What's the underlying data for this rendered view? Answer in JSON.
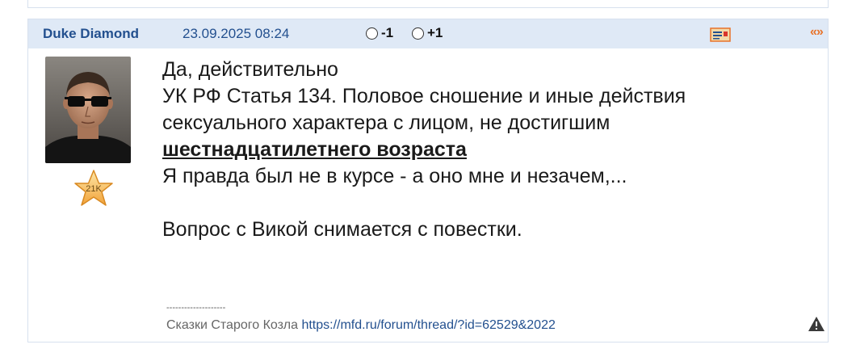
{
  "post": {
    "author": "Duke Diamond",
    "datetime": "23.09.2025 08:24",
    "vote_minus": "-1",
    "vote_plus": "+1",
    "quote_symbol": "«»",
    "rating": "21K",
    "body": {
      "line1": "Да, действительно",
      "line2": "УК РФ Статья 134. Половое сношение и иные действия",
      "line3": "сексуального характера с лицом, не достигшим",
      "link": "шестнадцатилетнего возраста",
      "line5": "Я правда был не в курсе - а оно мне и незачем,...",
      "line6": "Вопрос с Викой снимается с повестки."
    },
    "signature": {
      "separator": "--------------------",
      "text": "Сказки Старого Козла ",
      "link": "https://mfd.ru/forum/thread/?id=62529&2022"
    }
  },
  "icons": {
    "card": "card-icon",
    "quote": "quote-icon",
    "warning": "warning-icon",
    "rating": "star-icon"
  },
  "colors": {
    "header_bg": "#dfe9f6",
    "author": "#23508f",
    "quote": "#e8732a",
    "star": "#f5b942"
  }
}
